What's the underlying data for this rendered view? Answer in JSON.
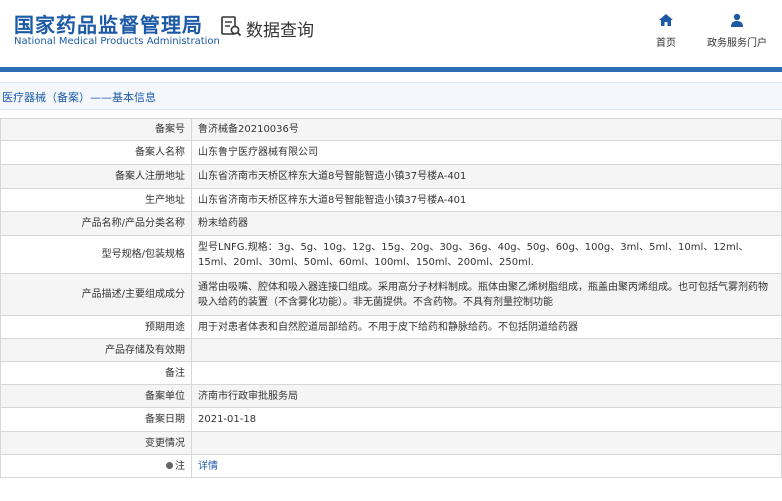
{
  "header": {
    "logo_cn": "国家药品监督管理局",
    "logo_en": "National Medical Products Administration",
    "db_title": "数据查询",
    "db_icon": "database-search-icon",
    "nav": [
      {
        "label": "首页",
        "icon": "home-icon"
      },
      {
        "label": "政务服务门户",
        "icon": "user-icon"
      }
    ],
    "brand_color": "#1d5aa6"
  },
  "section": {
    "title": "医疗器械（备案）——基本信息"
  },
  "rows": [
    {
      "key": "备案号",
      "value": "鲁济械备20210036号"
    },
    {
      "key": "备案人名称",
      "value": "山东鲁宁医疗器械有限公司"
    },
    {
      "key": "备案人注册地址",
      "value": "山东省济南市天桥区梓东大道8号智能智造小镇37号楼A-401"
    },
    {
      "key": "生产地址",
      "value": "山东省济南市天桥区梓东大道8号智能智造小镇37号楼A-401"
    },
    {
      "key": "产品名称/产品分类名称",
      "value": "粉末给药器"
    },
    {
      "key": "型号规格/包装规格",
      "value": "型号LNFG.规格：3g、5g、10g、12g、15g、20g、30g、36g、40g、50g、60g、100g、3ml、5ml、10ml、12ml、15ml、20ml、30ml、50ml、60ml、100ml、150ml、200ml、250ml."
    },
    {
      "key": "产品描述/主要组成成分",
      "value": "通常由吸嘴、腔体和吸入器连接口组成。采用高分子材料制成。瓶体由聚乙烯树脂组成，瓶盖由聚丙烯组成。也可包括气雾剂药物吸入给药的装置（不含雾化功能）。非无菌提供。不含药物。不具有剂量控制功能"
    },
    {
      "key": "预期用途",
      "value": "用于对患者体表和自然腔道局部给药。不用于皮下给药和静脉给药。不包括阴道给药器"
    },
    {
      "key": "产品存储及有效期",
      "value": ""
    },
    {
      "key": "备注",
      "value": ""
    },
    {
      "key": "备案单位",
      "value": "济南市行政审批服务局"
    },
    {
      "key": "备案日期",
      "value": "2021-01-18"
    },
    {
      "key": "变更情况",
      "value": ""
    }
  ],
  "note_row": {
    "key": "注",
    "link": "详情"
  }
}
